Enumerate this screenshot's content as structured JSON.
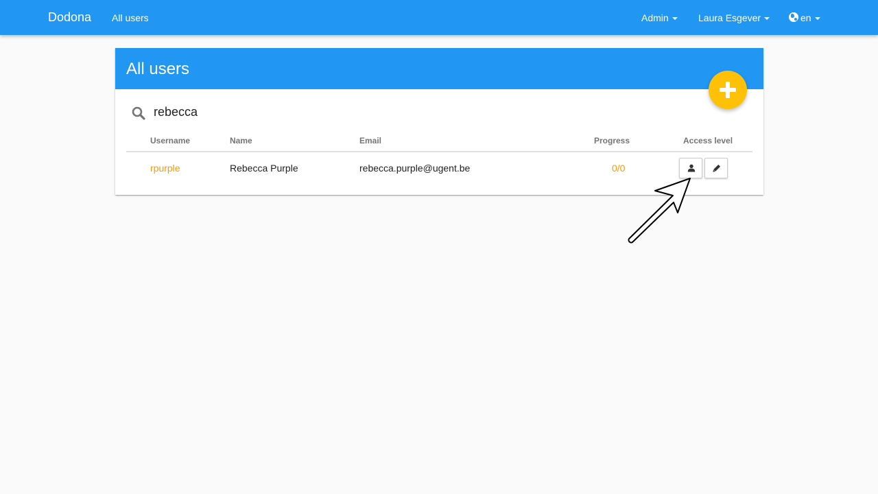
{
  "navbar": {
    "brand": "Dodona",
    "link_all_users": "All users",
    "menu_admin": "Admin",
    "menu_user": "Laura Esgever",
    "menu_language": "en",
    "brand_color": "#2196f3"
  },
  "card": {
    "title": "All users",
    "fab_icon": "plus-icon",
    "fab_color": "#ffc107"
  },
  "search": {
    "icon": "search-icon",
    "value": "rebecca"
  },
  "table": {
    "columns": [
      "Username",
      "Name",
      "Email",
      "Progress",
      "Access level"
    ],
    "rows": [
      {
        "username": "rpurple",
        "name": "Rebecca Purple",
        "email": "rebecca.purple@ugent.be",
        "progress": "0/0",
        "actions": [
          "user-icon",
          "pencil-icon"
        ]
      }
    ]
  },
  "accent_color": "#ff9800"
}
